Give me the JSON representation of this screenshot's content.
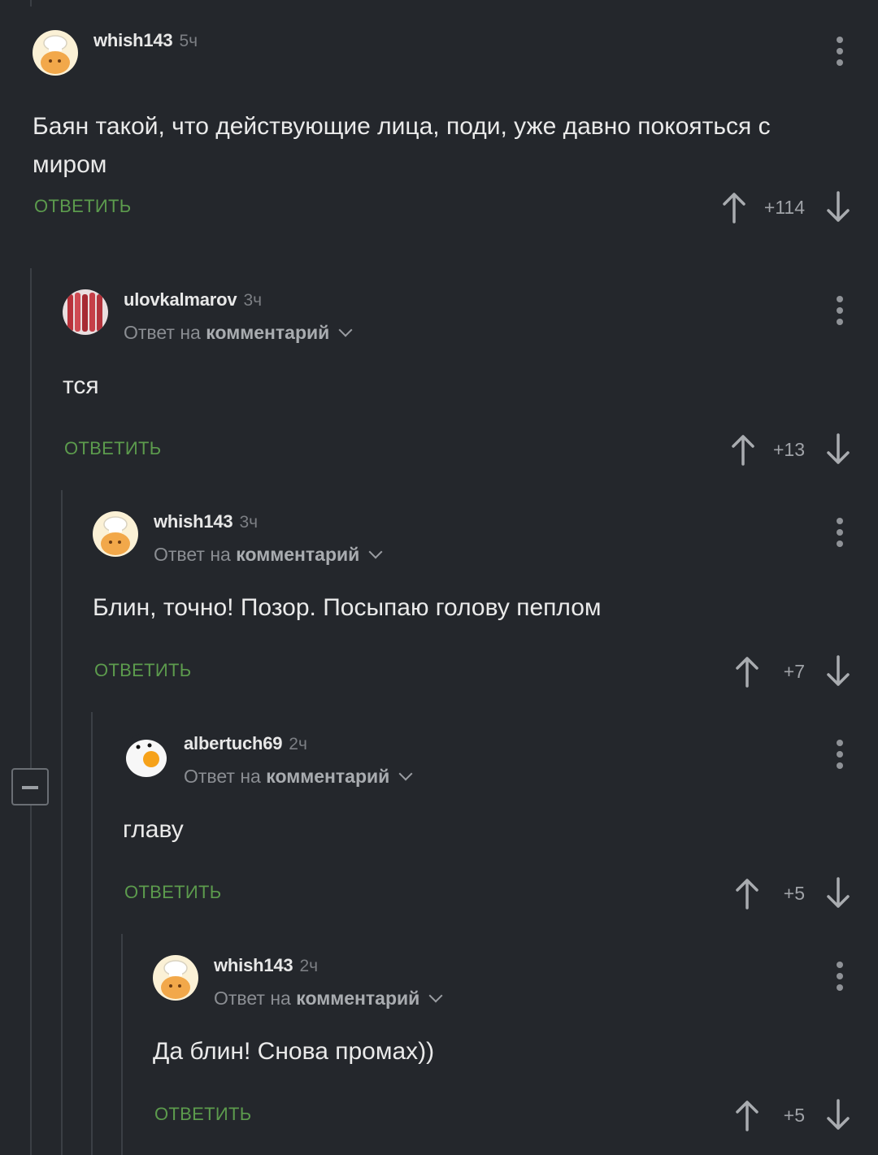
{
  "reply_label": "ОТВЕТИТЬ",
  "reply_to_prefix": "Ответ на",
  "reply_to_target": "комментарий",
  "colors": {
    "background": "#24272c",
    "reply": "#5c9b4d"
  },
  "comments": [
    {
      "user": "whish143",
      "time": "5ч",
      "text": "Баян такой, что действующие лица, поди, уже давно покояться с миром",
      "score": "+114",
      "avatar": "chef-cat-avatar"
    },
    {
      "user": "ulovkalmarov",
      "time": "3ч",
      "text": "тся",
      "score": "+13",
      "avatar": "squid-avatar"
    },
    {
      "user": "whish143",
      "time": "3ч",
      "text": "Блин, точно! Позор. Посыпаю голову пеплом",
      "score": "+7",
      "avatar": "chef-cat-avatar"
    },
    {
      "user": "albertuch69",
      "time": "2ч",
      "text": "главу",
      "score": "+5",
      "avatar": "egg-avatar"
    },
    {
      "user": "whish143",
      "time": "2ч",
      "text": "Да блин! Снова промах))",
      "score": "+5",
      "avatar": "chef-cat-avatar"
    }
  ]
}
